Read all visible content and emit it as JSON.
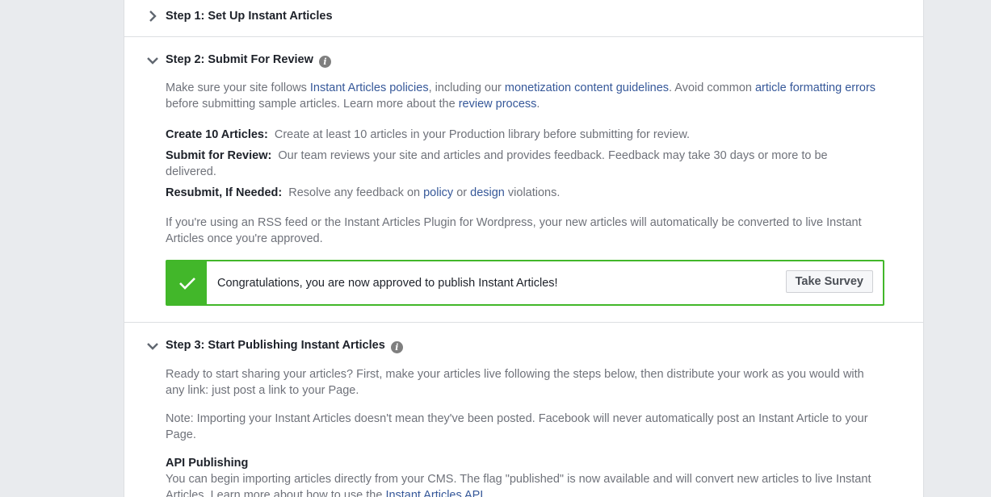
{
  "step1": {
    "title": "Step 1: Set Up Instant Articles"
  },
  "step2": {
    "title": "Step 2: Submit For Review",
    "intro": {
      "t1": "Make sure your site follows ",
      "link1": "Instant Articles policies",
      "t2": ", including our ",
      "link2": "monetization content guidelines",
      "t3": ". Avoid common ",
      "link3": "article formatting errors",
      "t4": " before submitting sample articles. Learn more about the ",
      "link4": "review process",
      "t5": "."
    },
    "items": [
      {
        "label": "Create 10 Articles:",
        "text": "Create at least 10 articles in your Production library before submitting for review."
      },
      {
        "label": "Submit for Review:",
        "text": "Our team reviews your site and articles and provides feedback. Feedback may take 30 days or more to be delivered."
      },
      {
        "label": "Resubmit, If Needed:",
        "t1": "Resolve any feedback on ",
        "link1": "policy",
        "t2": " or ",
        "link2": "design",
        "t3": " violations."
      }
    ],
    "rss_note": "If you're using an RSS feed or the Instant Articles Plugin for Wordpress, your new articles will automatically be converted to live Instant Articles once you're approved.",
    "success_message": "Congratulations, you are now approved to publish Instant Articles!",
    "survey_button": "Take Survey"
  },
  "step3": {
    "title": "Step 3: Start Publishing Instant Articles",
    "intro": "Ready to start sharing your articles? First, make your articles live following the steps below, then distribute your work as you would with any link: just post a link to your Page.",
    "note": "Note: Importing your Instant Articles doesn't mean they've been posted. Facebook will never automatically post an Instant Article to your Page.",
    "api_heading": "API Publishing",
    "api_t1": "You can begin importing articles directly from your CMS. The flag \"published\" is now available and will convert new articles to live Instant Articles. Learn more about how to use the ",
    "api_link": "Instant Articles API",
    "api_t2": "."
  },
  "colors": {
    "accent_green": "#42b72a",
    "link": "#365899",
    "body_text": "#6f727a"
  },
  "icons": {
    "collapsed": "chevron-right-icon",
    "expanded": "chevron-down-icon",
    "info": "info-icon",
    "success": "checkmark-icon"
  }
}
